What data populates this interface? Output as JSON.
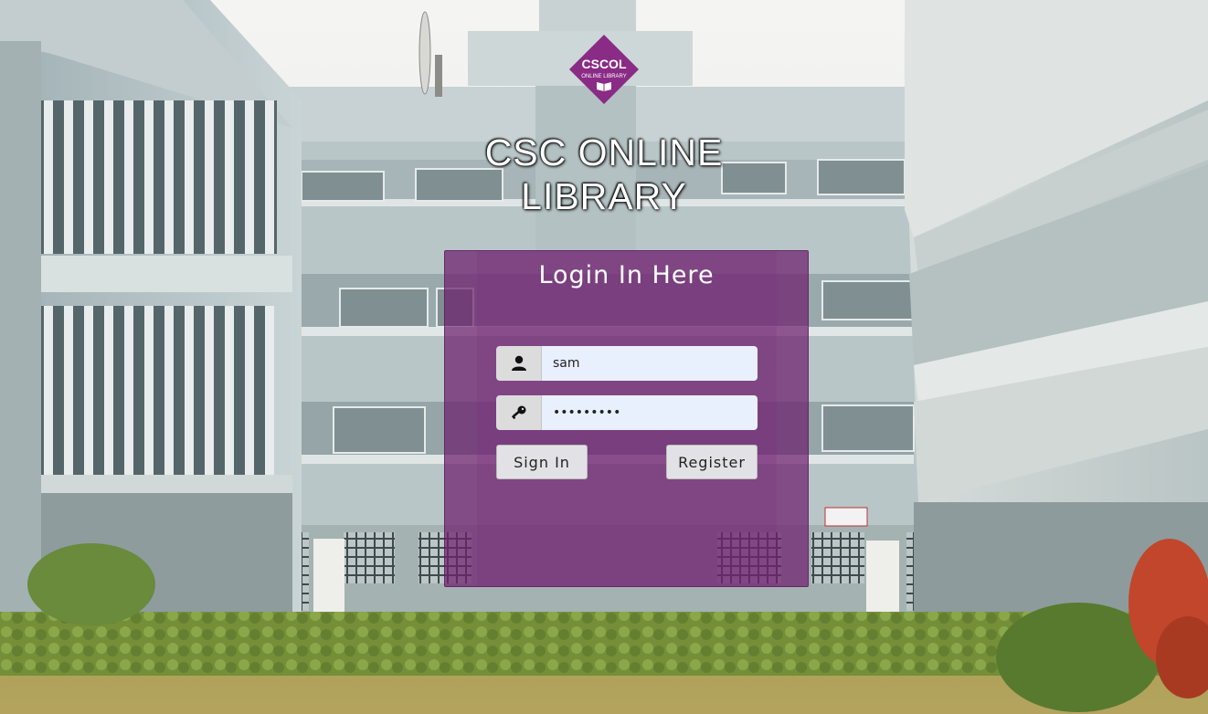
{
  "logo": {
    "text": "CSCOL",
    "subtext": "ONLINE LIBRARY"
  },
  "header": {
    "title": "CSC ONLINE LIBRARY"
  },
  "login": {
    "title": "Login In Here",
    "username": {
      "value": "sam",
      "icon": "user-icon"
    },
    "password": {
      "value": "•••••••••",
      "icon": "key-icon"
    },
    "signin_label": "Sign In",
    "register_label": "Register"
  },
  "colors": {
    "panel": "#6e1e6e",
    "logo": "#8a2b86",
    "input": "#e8f0fe",
    "button": "#e2e2e6"
  }
}
